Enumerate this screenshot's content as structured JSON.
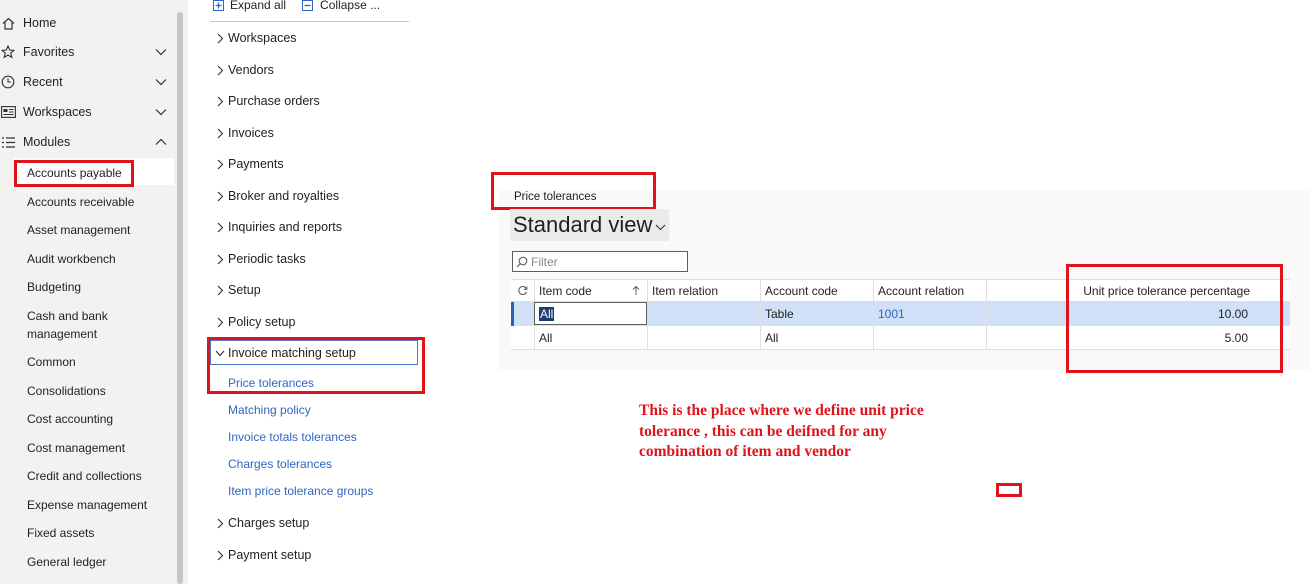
{
  "nav": {
    "top_items": [
      {
        "label": "Home",
        "icon": "home-icon",
        "has_chevron": false
      },
      {
        "label": "Favorites",
        "icon": "star-icon",
        "has_chevron": true,
        "chevron": "down"
      },
      {
        "label": "Recent",
        "icon": "clock-icon",
        "has_chevron": true,
        "chevron": "down"
      },
      {
        "label": "Workspaces",
        "icon": "workspaces-icon",
        "has_chevron": true,
        "chevron": "down"
      },
      {
        "label": "Modules",
        "icon": "modules-list-icon",
        "has_chevron": true,
        "chevron": "up"
      }
    ],
    "modules": [
      {
        "label": "Accounts payable",
        "selected": true
      },
      {
        "label": "Accounts receivable"
      },
      {
        "label": "Asset management"
      },
      {
        "label": "Audit workbench"
      },
      {
        "label": "Budgeting"
      },
      {
        "label": "Cash and bank management"
      },
      {
        "label": "Common"
      },
      {
        "label": "Consolidations"
      },
      {
        "label": "Cost accounting"
      },
      {
        "label": "Cost management"
      },
      {
        "label": "Credit and collections"
      },
      {
        "label": "Expense management"
      },
      {
        "label": "Fixed assets"
      },
      {
        "label": "General ledger"
      }
    ]
  },
  "tree": {
    "toolbar": {
      "expand_all": "Expand all",
      "collapse": "Collapse ..."
    },
    "groups": [
      {
        "label": "Workspaces"
      },
      {
        "label": "Vendors"
      },
      {
        "label": "Purchase orders"
      },
      {
        "label": "Invoices"
      },
      {
        "label": "Payments"
      },
      {
        "label": "Broker and royalties"
      },
      {
        "label": "Inquiries and reports"
      },
      {
        "label": "Periodic tasks"
      },
      {
        "label": "Setup"
      },
      {
        "label": "Policy setup"
      },
      {
        "label": "Invoice matching setup",
        "expanded": true
      },
      {
        "label": "Charges setup"
      },
      {
        "label": "Payment setup"
      }
    ],
    "invoice_matching_links": [
      "Price tolerances",
      "Matching policy",
      "Invoice totals tolerances",
      "Charges tolerances",
      "Item price tolerance groups"
    ]
  },
  "form": {
    "caption": "Price tolerances",
    "view_name": "Standard view",
    "filter_placeholder": "Filter",
    "columns": [
      "Item code",
      "Item relation",
      "Account code",
      "Account relation",
      "Unit price tolerance percentage"
    ],
    "rows": [
      {
        "item_code": "All",
        "item_relation": "",
        "account_code": "Table",
        "account_relation": "1001",
        "percentage": "10.00",
        "selected": true
      },
      {
        "item_code": "All",
        "item_relation": "",
        "account_code": "All",
        "account_relation": "",
        "percentage": "5.00",
        "selected": false
      }
    ]
  },
  "annotation": {
    "line1": "This is the place where we define unit price",
    "line2": "tolerance , this can be deifned for any",
    "line3": "combination of item and vendor"
  },
  "colors": {
    "accent": "#e0131b",
    "link": "#3166c1",
    "selected_row": "#cfe0f7",
    "nav_bg": "#f3f2f1"
  }
}
